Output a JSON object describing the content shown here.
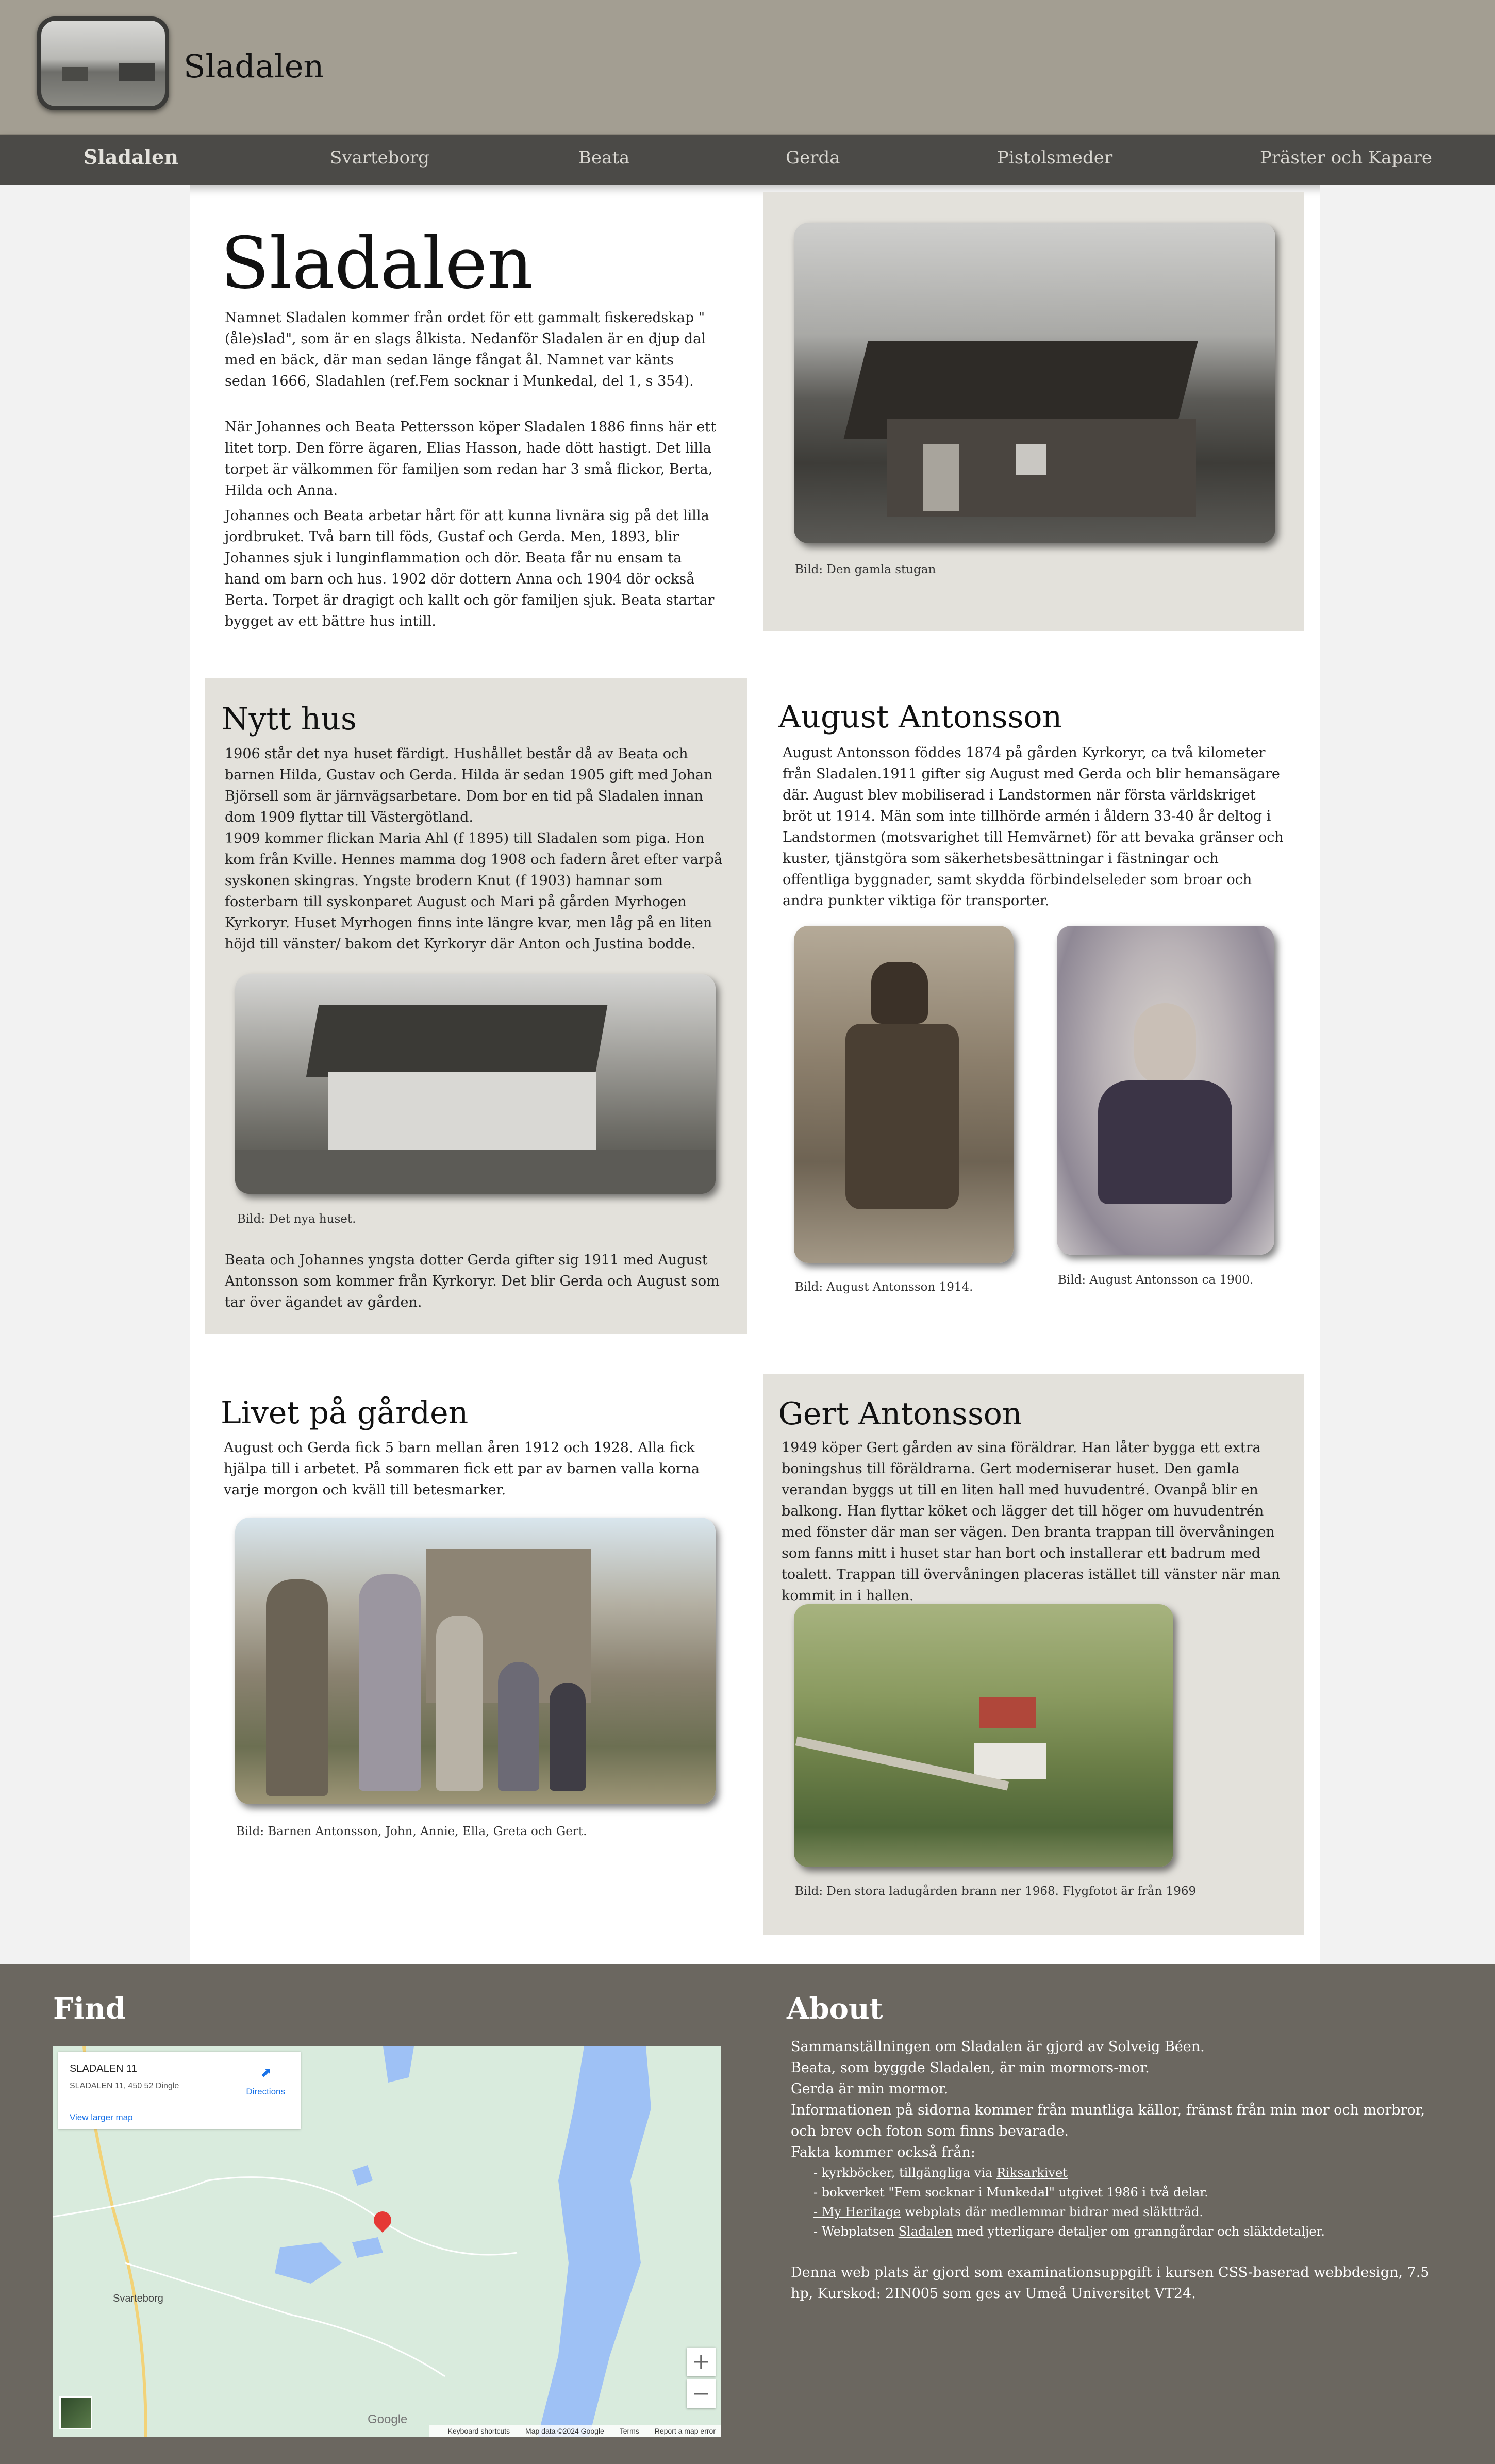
{
  "header": {
    "site_title": "Sladalen"
  },
  "nav": [
    {
      "label": "Sladalen",
      "active": true
    },
    {
      "label": "Svarteborg"
    },
    {
      "label": "Beata"
    },
    {
      "label": "Gerda"
    },
    {
      "label": "Pistolsmeder"
    },
    {
      "label": "Präster och Kapare"
    }
  ],
  "intro": {
    "title": "Sladalen",
    "p1": "Namnet Sladalen kommer från ordet för ett gammalt fiskeredskap \"(åle)slad\", som är en slags ålkista. Nedanför Sladalen är en djup dal med en bäck, där man sedan länge fångat ål. Namnet var känts sedan 1666, Sladahlen (ref.Fem socknar i Munkedal, del 1, s 354).",
    "p2": "När Johannes och Beata Pettersson köper Sladalen 1886 finns här ett litet torp. Den förre ägaren, Elias Hasson, hade dött hastigt. Det lilla torpet är välkommen för familjen som redan har 3 små flickor, Berta, Hilda och Anna.",
    "p3": "Johannes och Beata arbetar hårt för att kunna livnära sig på det lilla jordbruket. Två barn till föds, Gustaf och Gerda. Men, 1893, blir Johannes sjuk i lunginflammation och dör. Beata får nu ensam ta hand om barn och hus. 1902 dör dottern Anna och 1904 dör också Berta. Torpet är dragigt och kallt och gör familjen sjuk. Beata startar bygget av ett bättre hus intill.",
    "caption": "Bild: Den gamla stugan"
  },
  "nytt_hus": {
    "title": "Nytt hus",
    "p1": "1906 står det nya huset färdigt. Hushållet består då av Beata och barnen Hilda, Gustav och Gerda. Hilda är sedan 1905 gift med Johan Björsell som är järnvägsarbetare. Dom bor en tid på Sladalen innan dom 1909 flyttar till Västergötland.",
    "p2": "1909 kommer flickan Maria Ahl (f 1895) till Sladalen som piga. Hon kom från Kville. Hennes mamma dog 1908 och fadern året efter varpå syskonen skingras. Yngste brodern Knut (f 1903) hamnar som fosterbarn till syskonparet August och Mari på gården Myrhogen Kyrkoryr. Huset Myrhogen finns inte längre kvar, men låg på en liten höjd till vänster/ bakom det Kyrkoryr där Anton och Justina bodde.",
    "caption": "Bild: Det nya huset.",
    "p3": "Beata och Johannes yngsta dotter Gerda gifter sig 1911 med August Antonsson som kommer från Kyrkoryr. Det blir Gerda och August som tar över ägandet av gården."
  },
  "august": {
    "title": "August Antonsson",
    "p1": "August Antonsson föddes 1874 på gården Kyrkoryr, ca två kilometer från Sladalen.1911 gifter sig August med Gerda och blir hemansägare där. August blev mobiliserad i Landstormen när första världskriget bröt ut 1914. Män som inte tillhörde armén i åldern 33-40 år deltog i Landstormen (motsvarighet till Hemvärnet) för att bevaka gränser och kuster, tjänstgöra som säkerhetsbesättningar i fästningar och offentliga byggnader, samt skydda förbindelseleder som broar och andra punkter viktiga för transporter.",
    "caption1": "Bild: August Antonsson 1914.",
    "caption2": "Bild: August Antonsson ca 1900."
  },
  "livet": {
    "title": "Livet på gården",
    "p1": "August och Gerda fick 5 barn mellan åren 1912 och 1928. Alla fick hjälpa till i arbetet. På sommaren fick ett par av barnen valla korna varje morgon och kväll till betesmarker.",
    "caption": "Bild: Barnen Antonsson, John, Annie, Ella, Greta och Gert."
  },
  "gert": {
    "title": "Gert Antonsson",
    "p1": "1949 köper Gert gården av sina föräldrar. Han låter bygga ett extra boningshus till föräldrarna. Gert moderniserar huset. Den gamla verandan byggs ut till en liten hall med huvudentré. Ovanpå blir en balkong. Han flyttar köket och lägger det till höger om huvudentrén med fönster där man ser vägen. Den branta trappan till övervåningen som fanns mitt i huset star han bort och installerar ett badrum med toalett. Trappan till övervåningen placeras istället till vänster när man kommit in i hallen.",
    "caption": "Bild: Den stora ladugården brann ner 1968. Flygfotot är från 1969"
  },
  "footer": {
    "find_title": "Find",
    "about_title": "About",
    "map": {
      "place_name": "SLADALEN 11",
      "place_address": "SLADALEN 11, 450 52 Dingle",
      "directions": "Directions",
      "larger_map": "View larger map",
      "town": "Svarteborg",
      "google": "Google",
      "zoom_in": "+",
      "zoom_out": "−",
      "attr1": "Keyboard shortcuts",
      "attr2": "Map data ©2024 Google",
      "attr3": "Terms",
      "attr4": "Report a map error"
    },
    "about_lines": [
      "Sammanställningen om Sladalen är gjord av Solveig Béen.",
      "Beata, som byggde Sladalen, är min mormors-mor.",
      "Gerda är min mormor.",
      "Informationen på sidorna kommer från muntliga källor, främst från min mor och morbror, och brev och foton som finns bevarade.",
      "Fakta kommer också från:"
    ],
    "sources": {
      "s1_pre": "- kyrkböcker, tillgängliga via ",
      "s1_link": "Riksarkivet",
      "s2": "- bokverket \"Fem socknar i Munkedal\" utgivet 1986 i två delar.",
      "s3_link": "- My Heritage",
      "s3_post": " webplats där medlemmar bidrar med släktträd.",
      "s4_pre": "- Webplatsen ",
      "s4_link": "Sladalen",
      "s4_post": " med ytterligare detaljer om granngårdar och släktdetaljer."
    },
    "note": "Denna web plats är gjord som examinationsuppgift i kursen CSS-baserad webbdesign, 7.5 hp, Kurskod: 2IN005 som ges av Umeå Universitet VT24."
  }
}
